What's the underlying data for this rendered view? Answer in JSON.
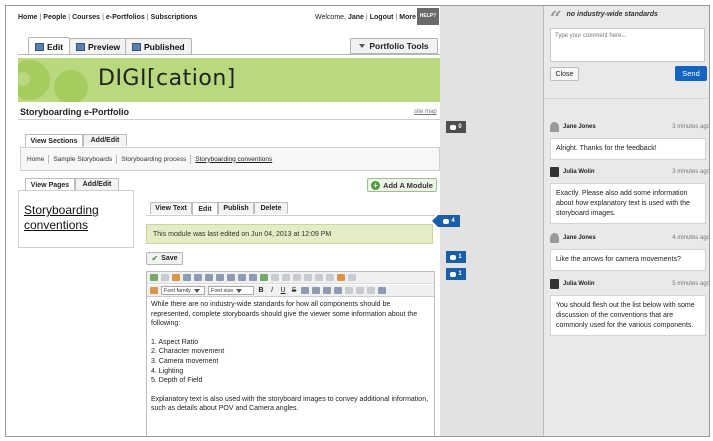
{
  "nav": {
    "links": [
      "Home",
      "People",
      "Courses",
      "e-Portfolios",
      "Subscriptions"
    ],
    "welcome_prefix": "Welcome,",
    "user": "Jane",
    "logout": "Logout",
    "more": "More",
    "help": "HELP?"
  },
  "modes": {
    "edit": "Edit",
    "preview": "Preview",
    "published": "Published",
    "tools": "Portfolio Tools"
  },
  "banner": {
    "logo": "DIGI[cation]"
  },
  "portfolio": {
    "title": "Storyboarding e-Portfolio",
    "sitemap": "site map"
  },
  "section_tabs": {
    "view": "View Sections",
    "add_edit": "Add/Edit"
  },
  "breadcrumb": [
    "Home",
    "Sample Storyboards",
    "Storyboarding process",
    "Storyboarding conventions"
  ],
  "page_tabs": {
    "view": "View Pages",
    "add_edit": "Add/Edit"
  },
  "add_module": "Add A Module",
  "page_link": "Storyboarding conventions",
  "module_tabs": [
    "View Text",
    "Edit",
    "Publish",
    "Delete"
  ],
  "edited_notice": "This module was last edited on Jun 04, 2013 at 12:09 PM",
  "save": "Save",
  "toolbar": {
    "font_family": "Font family",
    "font_size": "Font size"
  },
  "editor": {
    "para1": "While there are no industry-wide standards for how all components should be represented, complete storyboards should give the viewer some information about the following:",
    "list": [
      "1. Aspect Ratio",
      "2. Character movement",
      "3. Camera movement",
      "4. Lighting",
      "5. Depth of Field"
    ],
    "para2": "Explanatory text is also used with the storyboard images to convey additional information, such as details about POV and Camera angles."
  },
  "flags": {
    "section": "0",
    "module": "4",
    "save": "1",
    "toolbar": "1"
  },
  "panel": {
    "quote": "no industry-wide standards",
    "placeholder": "Type your comment here...",
    "close": "Close",
    "send": "Send",
    "comments": [
      {
        "author": "Jane Jones",
        "time": "3 minutes ago",
        "text": "Alright. Thanks for the feedback!"
      },
      {
        "author": "Julia Wolin",
        "time": "3 minutes ago",
        "text": "Exactly. Please also add some information about how explanatory text is used with the storyboard images."
      },
      {
        "author": "Jane Jones",
        "time": "4 minutes ago",
        "text": "Like the arrows for camera movements?"
      },
      {
        "author": "Julia Wolin",
        "time": "5 minutes ago",
        "text": "You should flesh out the list below with some discussion of the conventions that are commonly used for the various components."
      }
    ]
  },
  "colors": {
    "banner": "#b9d97f",
    "accent_blue": "#1463c1",
    "flag_blue": "#1a5ea8",
    "notice": "#e3ecc4"
  }
}
